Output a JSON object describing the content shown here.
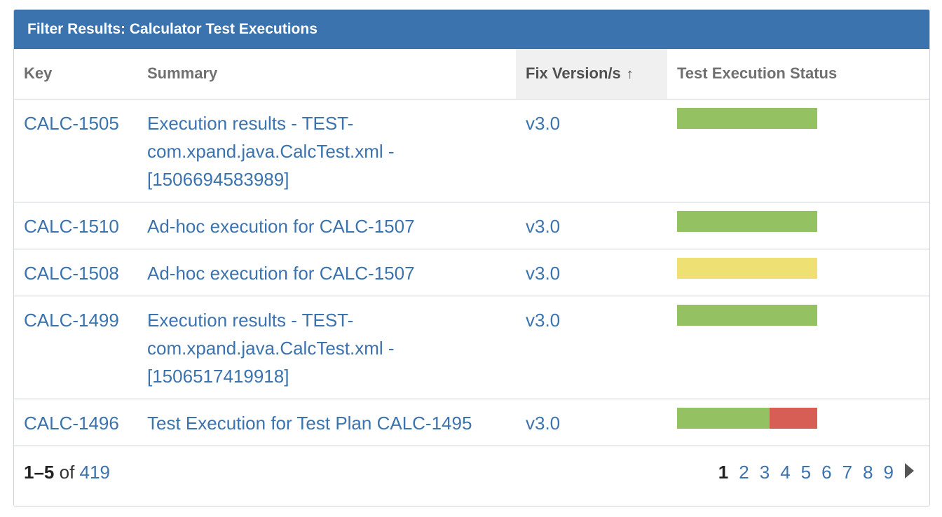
{
  "panel": {
    "title": "Filter Results: Calculator Test Executions"
  },
  "columns": {
    "key": "Key",
    "summary": "Summary",
    "fix_version": "Fix Version/s",
    "status": "Test Execution Status"
  },
  "rows": [
    {
      "key": "CALC-1505",
      "summary_lines": [
        "Execution results - TEST-",
        "com.xpand.java.CalcTest.xml -",
        "[1506694583989]"
      ],
      "fix": "v3.0",
      "status": {
        "pass": 1.0,
        "todo": 0,
        "fail": 0
      }
    },
    {
      "key": "CALC-1510",
      "summary_lines": [
        "Ad-hoc execution for CALC-1507"
      ],
      "fix": "v3.0",
      "status": {
        "pass": 1.0,
        "todo": 0,
        "fail": 0
      }
    },
    {
      "key": "CALC-1508",
      "summary_lines": [
        "Ad-hoc execution for CALC-1507"
      ],
      "fix": "v3.0",
      "status": {
        "pass": 0,
        "todo": 1.0,
        "fail": 0
      }
    },
    {
      "key": "CALC-1499",
      "summary_lines": [
        "Execution results - TEST-",
        "com.xpand.java.CalcTest.xml -",
        "[1506517419918]"
      ],
      "fix": "v3.0",
      "status": {
        "pass": 1.0,
        "todo": 0,
        "fail": 0
      }
    },
    {
      "key": "CALC-1496",
      "summary_lines": [
        "Test Execution for Test Plan CALC-1495"
      ],
      "fix": "v3.0",
      "status": {
        "pass": 0.66,
        "todo": 0,
        "fail": 0.34
      }
    }
  ],
  "footer": {
    "range": "1–5",
    "of": "of",
    "total": "419",
    "pages": [
      "1",
      "2",
      "3",
      "4",
      "5",
      "6",
      "7",
      "8",
      "9"
    ],
    "current_page": "1"
  },
  "colors": {
    "header_bg": "#3b73af",
    "link": "#3b73af",
    "pass": "#94c162",
    "todo": "#efe074",
    "fail": "#d65e55"
  },
  "icons": {
    "sort": "arrow-up-icon",
    "next": "triangle-right-icon"
  }
}
